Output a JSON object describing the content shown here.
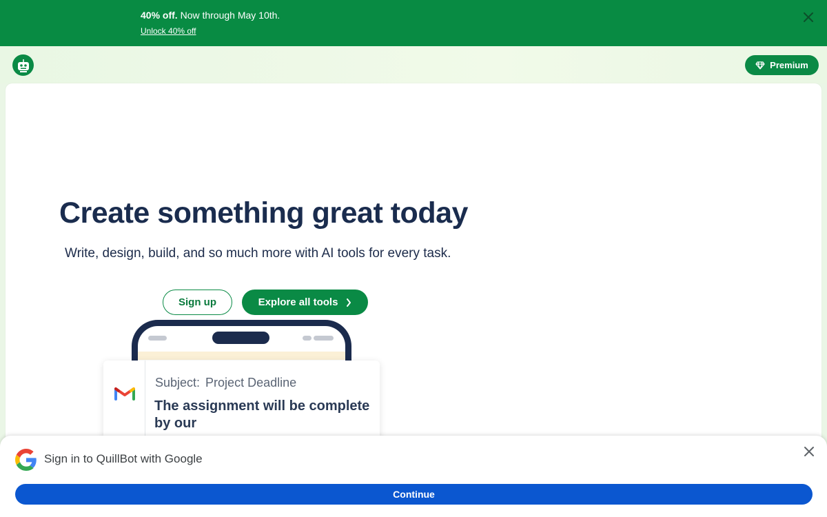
{
  "promo": {
    "bold_text": "40% off.",
    "text": " Now through May 10th.",
    "link_label": "Unlock 40% off",
    "close_icon": "close-icon"
  },
  "header": {
    "logo_icon": "quillbot-robot-logo",
    "premium_label": "Premium",
    "premium_icon": "diamond-icon"
  },
  "hero": {
    "title": "Create something great today",
    "subtitle": "Write, design, build, and so much more with AI tools for every task.",
    "signup_label": "Sign up",
    "explore_label": "Explore all tools"
  },
  "illustration": {
    "email": {
      "subject_label": "Subject:",
      "subject_value": "Project Deadline",
      "body": "The assignment will be complete by our",
      "icon": "gmail-icon"
    }
  },
  "google_signin": {
    "title": "Sign in to QuillBot with Google",
    "continue_label": "Continue",
    "icon": "google-icon"
  },
  "colors": {
    "brand_green": "#0a8a45",
    "promo_green": "#088b43",
    "navy": "#1a2c4e",
    "google_blue": "#0b57d0"
  }
}
